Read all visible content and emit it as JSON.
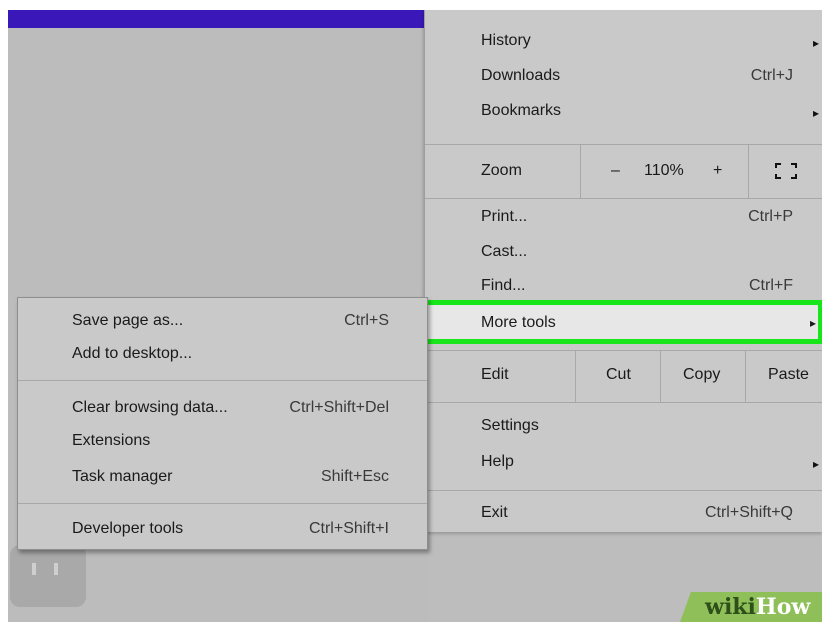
{
  "main_menu": {
    "history": {
      "label": "History",
      "arrow": "▸"
    },
    "downloads": {
      "label": "Downloads",
      "shortcut": "Ctrl+J"
    },
    "bookmarks": {
      "label": "Bookmarks",
      "arrow": "▸"
    },
    "zoom": {
      "label": "Zoom",
      "minus": "–",
      "level": "110%",
      "plus": "+",
      "fullscreen_icon": "fullscreen-icon"
    },
    "print": {
      "label": "Print...",
      "shortcut": "Ctrl+P"
    },
    "cast": {
      "label": "Cast..."
    },
    "find": {
      "label": "Find...",
      "shortcut": "Ctrl+F"
    },
    "more_tools": {
      "label": "More tools",
      "arrow": "▸"
    },
    "edit": {
      "label": "Edit",
      "cut": "Cut",
      "copy": "Copy",
      "paste": "Paste"
    },
    "settings": {
      "label": "Settings"
    },
    "help": {
      "label": "Help",
      "arrow": "▸"
    },
    "exit": {
      "label": "Exit",
      "shortcut": "Ctrl+Shift+Q"
    }
  },
  "sub_menu": {
    "save_page": {
      "label": "Save page as...",
      "shortcut": "Ctrl+S"
    },
    "add_desktop": {
      "label": "Add to desktop..."
    },
    "clear_data": {
      "label": "Clear browsing data...",
      "shortcut": "Ctrl+Shift+Del"
    },
    "extensions": {
      "label": "Extensions"
    },
    "task_manager": {
      "label": "Task manager",
      "shortcut": "Shift+Esc"
    },
    "dev_tools": {
      "label": "Developer tools",
      "shortcut": "Ctrl+Shift+I"
    }
  },
  "watermark": {
    "brand_wiki": "wiki",
    "brand_how": "How"
  },
  "colors": {
    "highlight_border": "#19e61a",
    "top_bar": "#3a17b8",
    "menu_bg": "#c9c9c9"
  }
}
